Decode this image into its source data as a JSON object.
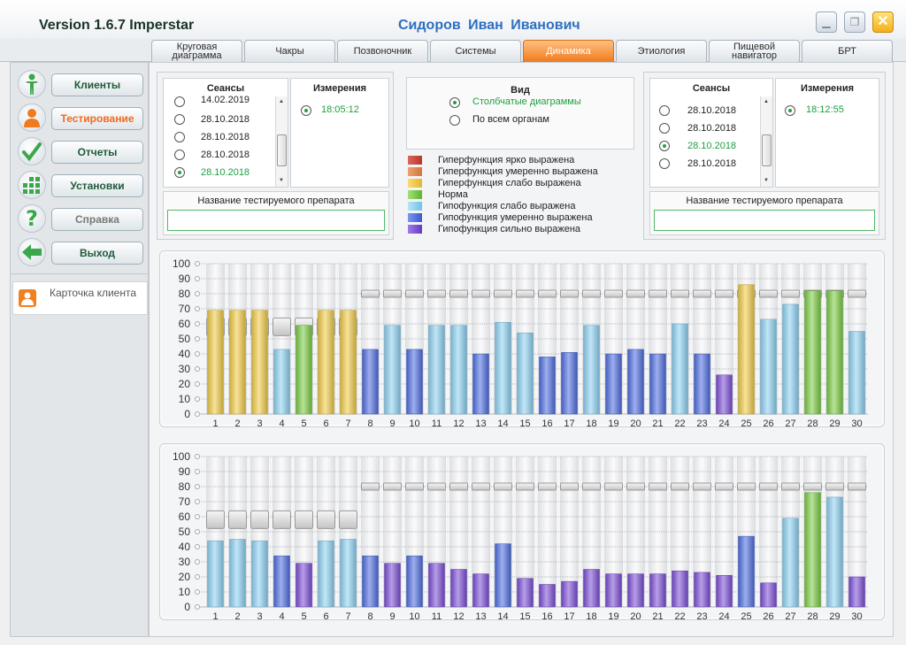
{
  "titlebar": {
    "version": "Version 1.6.7 Imperstar",
    "user": "Сидоров Иван Иванович"
  },
  "tabs": [
    {
      "label": "Круговая диаграмма",
      "active": false
    },
    {
      "label": "Чакры",
      "active": false
    },
    {
      "label": "Позвоночник",
      "active": false
    },
    {
      "label": "Системы",
      "active": false
    },
    {
      "label": "Динамика",
      "active": true
    },
    {
      "label": "Этиология",
      "active": false
    },
    {
      "label": "Пищевой навигатор",
      "active": false
    },
    {
      "label": "БРТ",
      "active": false
    }
  ],
  "sidebar": {
    "items": [
      {
        "label": "Клиенты",
        "icon": "person-icon"
      },
      {
        "label": "Тестирование",
        "icon": "user-icon"
      },
      {
        "label": "Отчеты",
        "icon": "checkmark-icon"
      },
      {
        "label": "Установки",
        "icon": "grid-icon"
      },
      {
        "label": "Справка",
        "icon": "question-icon"
      },
      {
        "label": "Выход",
        "icon": "arrow-left-icon"
      }
    ],
    "card_label": "Карточка клиента"
  },
  "left_group": {
    "sessions_title": "Сеансы",
    "sessions": [
      {
        "label": "14.02.2019",
        "selected": false
      },
      {
        "label": "28.10.2018",
        "selected": false
      },
      {
        "label": "28.10.2018",
        "selected": false
      },
      {
        "label": "28.10.2018",
        "selected": false
      },
      {
        "label": "28.10.2018",
        "selected": true
      }
    ],
    "measurements_title": "Измерения",
    "measurements": [
      {
        "label": "18:05:12",
        "selected": true
      }
    ],
    "drug_label": "Название тестируемого препарата",
    "drug_value": ""
  },
  "view": {
    "title": "Вид",
    "options": [
      {
        "label": "Столбчатые диаграммы",
        "selected": true
      },
      {
        "label": "По всем органам",
        "selected": false
      }
    ]
  },
  "legend": [
    {
      "label": "Гиперфункция ярко выражена",
      "color": "#c8443a"
    },
    {
      "label": "Гиперфункция умеренно выражена",
      "color": "#e28a52"
    },
    {
      "label": "Гиперфункция слабо выражена",
      "color": "#f1cc47"
    },
    {
      "label": "Норма",
      "color": "#7ccc45"
    },
    {
      "label": "Гипофункция слабо выражена",
      "color": "#8fd2f2"
    },
    {
      "label": "Гипофункция умеренно выражена",
      "color": "#4f6ee0"
    },
    {
      "label": "Гипофункция сильно выражена",
      "color": "#7c4fd6"
    }
  ],
  "right_group": {
    "sessions_title": "Сеансы",
    "sessions": [
      {
        "label": "28.10.2018",
        "selected": false
      },
      {
        "label": "28.10.2018",
        "selected": false
      },
      {
        "label": "28.10.2018",
        "selected": true
      },
      {
        "label": "28.10.2018",
        "selected": false
      }
    ],
    "measurements_title": "Измерения",
    "measurements": [
      {
        "label": "18:12:55",
        "selected": true
      }
    ],
    "drug_label": "Название тестируемого препарата",
    "drug_value": ""
  },
  "chart_data": [
    {
      "type": "bar",
      "ylim": [
        0,
        100
      ],
      "yticks": [
        0,
        10,
        20,
        30,
        40,
        50,
        60,
        70,
        80,
        90,
        100
      ],
      "categories": [
        "1",
        "2",
        "3",
        "4",
        "5",
        "6",
        "7",
        "8",
        "9",
        "10",
        "11",
        "12",
        "13",
        "14",
        "15",
        "16",
        "17",
        "18",
        "19",
        "20",
        "21",
        "22",
        "23",
        "24",
        "25",
        "26",
        "27",
        "28",
        "29",
        "30"
      ],
      "values": [
        69,
        69,
        69,
        43,
        59,
        69,
        69,
        43,
        59,
        43,
        59,
        59,
        40,
        61,
        54,
        38,
        41,
        59,
        40,
        43,
        40,
        60,
        40,
        26,
        86,
        63,
        73,
        82,
        82,
        55
      ],
      "levels": [
        "hyper-weak",
        "hyper-weak",
        "hyper-weak",
        "hypo-weak",
        "norm",
        "hyper-weak",
        "hyper-weak",
        "hypo-moderate",
        "hypo-weak",
        "hypo-moderate",
        "hypo-weak",
        "hypo-weak",
        "hypo-moderate",
        "hypo-weak",
        "hypo-weak",
        "hypo-moderate",
        "hypo-moderate",
        "hypo-weak",
        "hypo-moderate",
        "hypo-moderate",
        "hypo-moderate",
        "hypo-weak",
        "hypo-moderate",
        "hypo-strong",
        "hyper-weak",
        "hypo-weak",
        "hypo-weak",
        "norm",
        "norm",
        "hypo-weak"
      ],
      "markers": [
        58,
        58,
        58,
        58,
        58,
        58,
        58,
        80,
        80,
        80,
        80,
        80,
        80,
        80,
        80,
        80,
        80,
        80,
        80,
        80,
        80,
        80,
        80,
        80,
        80,
        80,
        80,
        80,
        80,
        80
      ],
      "grid": true
    },
    {
      "type": "bar",
      "ylim": [
        0,
        100
      ],
      "yticks": [
        0,
        10,
        20,
        30,
        40,
        50,
        60,
        70,
        80,
        90,
        100
      ],
      "categories": [
        "1",
        "2",
        "3",
        "4",
        "5",
        "6",
        "7",
        "8",
        "9",
        "10",
        "11",
        "12",
        "13",
        "14",
        "15",
        "16",
        "17",
        "18",
        "19",
        "20",
        "21",
        "22",
        "23",
        "24",
        "25",
        "26",
        "27",
        "28",
        "29",
        "30"
      ],
      "values": [
        44,
        45,
        44,
        34,
        29,
        44,
        45,
        34,
        29,
        34,
        29,
        25,
        22,
        42,
        19,
        15,
        17,
        25,
        22,
        22,
        22,
        24,
        23,
        21,
        47,
        16,
        59,
        76,
        73,
        20
      ],
      "levels": [
        "hypo-weak",
        "hypo-weak",
        "hypo-weak",
        "hypo-moderate",
        "hypo-strong",
        "hypo-weak",
        "hypo-weak",
        "hypo-moderate",
        "hypo-strong",
        "hypo-moderate",
        "hypo-strong",
        "hypo-strong",
        "hypo-strong",
        "hypo-moderate",
        "hypo-strong",
        "hypo-strong",
        "hypo-strong",
        "hypo-strong",
        "hypo-strong",
        "hypo-strong",
        "hypo-strong",
        "hypo-strong",
        "hypo-strong",
        "hypo-strong",
        "hypo-moderate",
        "hypo-strong",
        "hypo-weak",
        "norm",
        "hypo-weak",
        "hypo-strong"
      ],
      "markers": [
        58,
        58,
        58,
        58,
        58,
        58,
        58,
        80,
        80,
        80,
        80,
        80,
        80,
        80,
        80,
        80,
        80,
        80,
        80,
        80,
        80,
        80,
        80,
        80,
        80,
        80,
        80,
        80,
        80,
        80
      ],
      "grid": true
    }
  ],
  "level_colors": {
    "hyper-weak": "#f1cc47",
    "norm": "#7ccc45",
    "hypo-weak": "#8fd2f2",
    "hypo-moderate": "#4f6ee0",
    "hypo-strong": "#7c4fd6"
  }
}
